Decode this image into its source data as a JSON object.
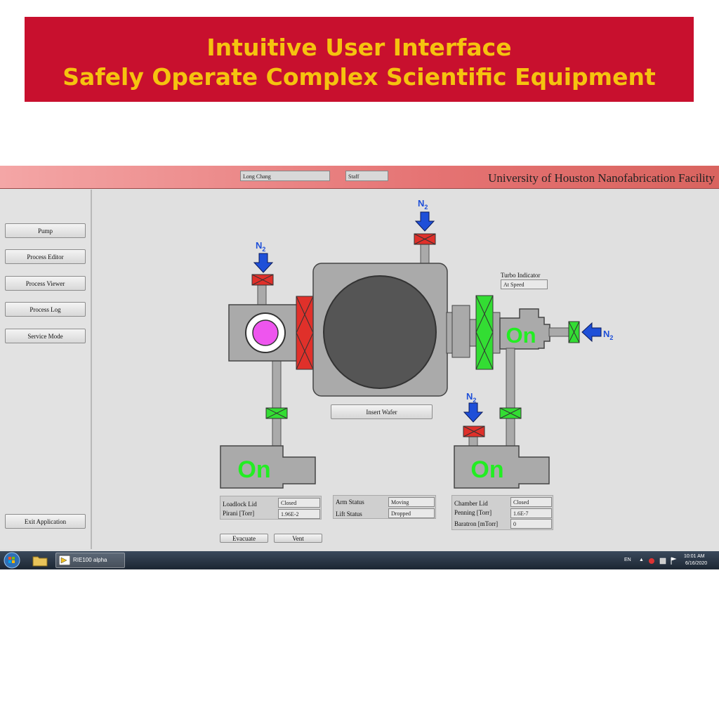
{
  "banner": {
    "line1": "Intuitive User Interface",
    "line2": "Safely Operate Complex Scientific Equipment"
  },
  "header": {
    "user_name": "Long Chang",
    "user_role": "Staff",
    "facility": "University of Houston Nanofabrication Facility"
  },
  "sidebar": {
    "items": [
      {
        "label": "Pump"
      },
      {
        "label": "Process Editor"
      },
      {
        "label": "Process Viewer"
      },
      {
        "label": "Process Log"
      },
      {
        "label": "Service Mode"
      }
    ],
    "exit_label": "Exit Application"
  },
  "diagram": {
    "n2_label": "N",
    "n2_sub": "2",
    "pump_on_text": "On",
    "insert_wafer_label": "Insert Wafer",
    "turbo_indicator_label": "Turbo Indicator",
    "turbo_indicator_value": "At Speed",
    "colors": {
      "on": "#22ee22",
      "valve_open": "#33dd33",
      "valve_closed": "#e0302a",
      "n2_arrow": "#1e4fd8",
      "wafer": "#ee55ee"
    }
  },
  "loadlock_panel": {
    "lid_label": "Loadlock Lid",
    "lid_value": "Closed",
    "pirani_label": "Pirani [Torr]",
    "pirani_value": "1.96E-2"
  },
  "arm_panel": {
    "arm_label": "Arm Status",
    "arm_value": "Moving",
    "lift_label": "Lift Status",
    "lift_value": "Dropped"
  },
  "chamber_panel": {
    "lid_label": "Chamber Lid",
    "lid_value": "Closed",
    "penning_label": "Penning [Torr]",
    "penning_value": "1.6E-7",
    "baratron_label": "Baratron [mTorr]",
    "baratron_value": "0"
  },
  "actions": {
    "evacuate_label": "Evacuate",
    "vent_label": "Vent"
  },
  "taskbar": {
    "app_label": "RIE100 alpha",
    "lang": "EN",
    "time": "10:01 AM",
    "date": "6/16/2020"
  }
}
